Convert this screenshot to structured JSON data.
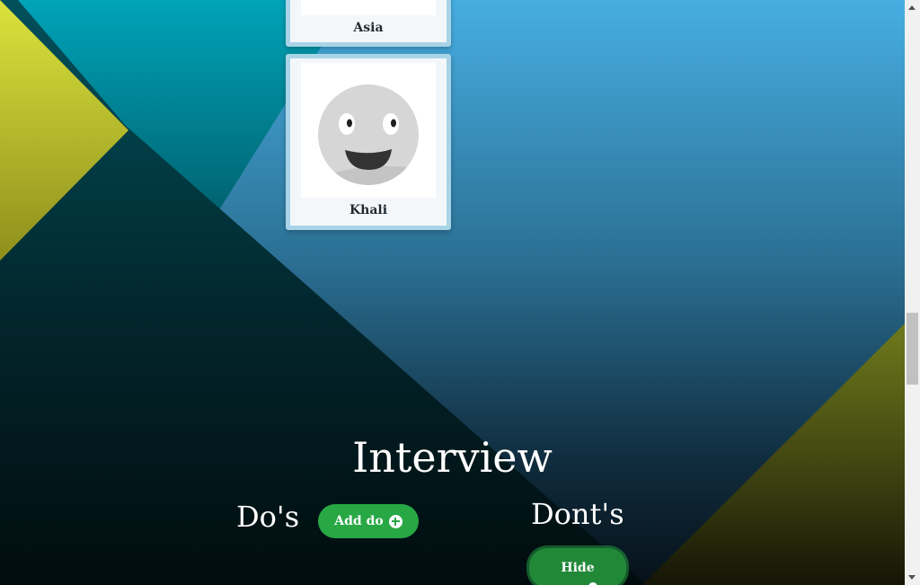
{
  "cards": [
    {
      "name": "Asia",
      "avatar_icon": "placeholder-image-icon"
    },
    {
      "name": "Khali",
      "avatar_icon": "smiley-face-icon"
    }
  ],
  "interview": {
    "title": "Interview",
    "dos": {
      "title": "Do's",
      "add_button_label": "Add do",
      "add_button_icon": "plus-circle-icon"
    },
    "donts": {
      "title": "Dont's",
      "hide_button_label": "Hide"
    }
  },
  "colors": {
    "button_green": "#28a745",
    "button_green_dark": "#218838",
    "card_border": "#a9d3e6",
    "background_top": "#47aee2",
    "background_bottom": "#040e14",
    "accent_yellow": "#d8e13e"
  }
}
